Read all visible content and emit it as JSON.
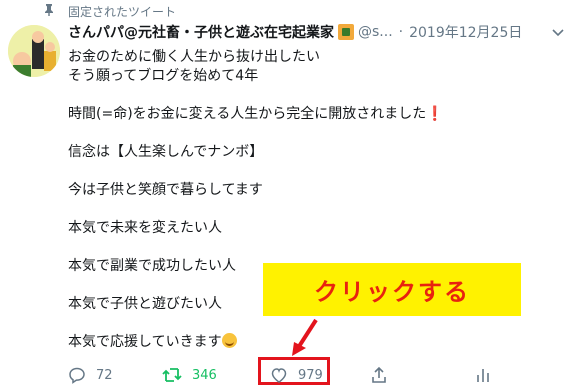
{
  "tweet": {
    "pinned_label": "固定されたツイート",
    "author_name": "さんパパ@元社畜・子供と遊ぶ在宅起業家",
    "handle": "@s...",
    "separator": "·",
    "date": "2019年12月25日",
    "lines": [
      "お金のために働く人生から抜け出したい",
      "そう願ってブログを始めて4年",
      "",
      "時間(=命)をお金に変える人生から完全に開放されました",
      "",
      "信念は【人生楽しんでナンボ】",
      "",
      "今は子供と笑顔で暮らしてます",
      "",
      "本気で未来を変えたい人",
      "",
      "本気で副業で成功したい人",
      "",
      "本気で子供と遊びたい人",
      "",
      "本気で応援していきます"
    ],
    "exclamation": "❗",
    "actions": {
      "reply_count": "72",
      "retweet_count": "346",
      "like_count": "979"
    }
  },
  "annotation": {
    "callout_text": "クリックする"
  },
  "colors": {
    "callout_bg": "#fff200",
    "callout_text": "#e8230f",
    "highlight_border": "#e3141d",
    "retweet": "#17bf63"
  }
}
